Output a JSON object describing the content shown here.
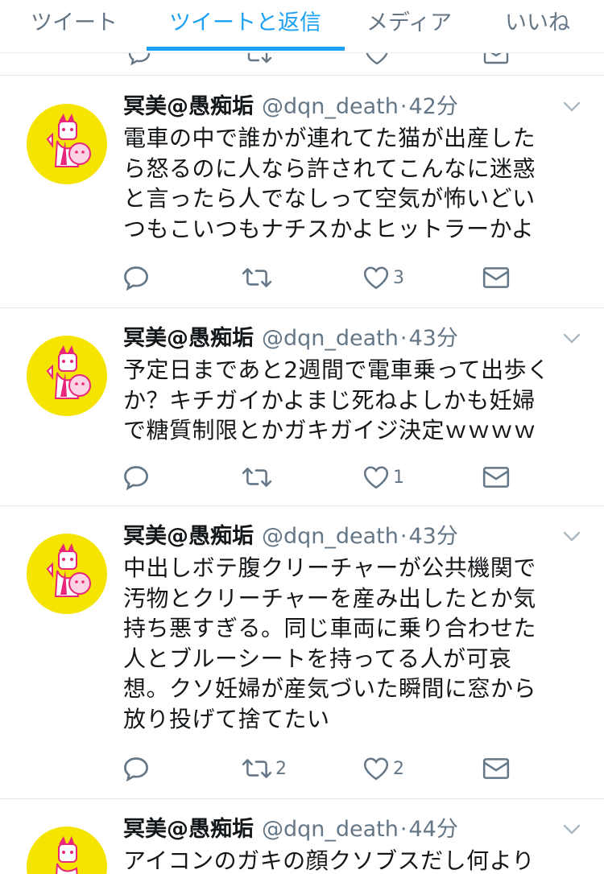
{
  "tabs": [
    {
      "label": "ツイート",
      "active": false
    },
    {
      "label": "ツイートと返信",
      "active": true
    },
    {
      "label": "メディア",
      "active": false
    },
    {
      "label": "いいね",
      "active": false
    }
  ],
  "tweets": [
    {
      "name": "冥美@愚痴垢",
      "handle": "@dqn_death",
      "dot": "·",
      "time": "42分",
      "lines": [
        "電車の中で誰かが連れてた猫が出産した",
        "ら怒るのに人なら許されてこんなに迷惑",
        "と言ったら人でなしって空気が怖いどい",
        "つもこいつもナチスかよヒットラーかよ"
      ],
      "retweets": "",
      "likes": "3"
    },
    {
      "name": "冥美@愚痴垢",
      "handle": "@dqn_death",
      "dot": "·",
      "time": "43分",
      "lines": [
        "予定日まであと2週間で電車乗って出歩く",
        "か？キチガイかよまじ死ねよしかも妊婦",
        "で糖質制限とかガキガイジ決定ｗｗｗｗ"
      ],
      "retweets": "",
      "likes": "1"
    },
    {
      "name": "冥美@愚痴垢",
      "handle": "@dqn_death",
      "dot": "·",
      "time": "43分",
      "lines": [
        "中出しボテ腹クリーチャーが公共機関で",
        "汚物とクリーチャーを産み出したとか気",
        "持ち悪すぎる。同じ車両に乗り合わせた",
        "人とブルーシートを持ってる人が可哀",
        "想。クソ妊婦が産気づいた瞬間に窓から",
        "放り投げて捨てたい"
      ],
      "retweets": "2",
      "likes": "2"
    },
    {
      "name": "冥美@愚痴垢",
      "handle": "@dqn_death",
      "dot": "·",
      "time": "44分",
      "lines": [
        "アイコンのガキの顔クソブスだし何より"
      ],
      "retweets": "",
      "likes": ""
    }
  ],
  "icons": {
    "reply": "reply-icon",
    "retweet": "retweet-icon",
    "like": "heart-icon",
    "dm": "envelope-icon",
    "caret": "chevron-down-icon"
  },
  "colors": {
    "accent": "#1da1f2",
    "muted": "#657786",
    "avatar_bg": "#f5e400",
    "avatar_pink": "#e8267a"
  }
}
